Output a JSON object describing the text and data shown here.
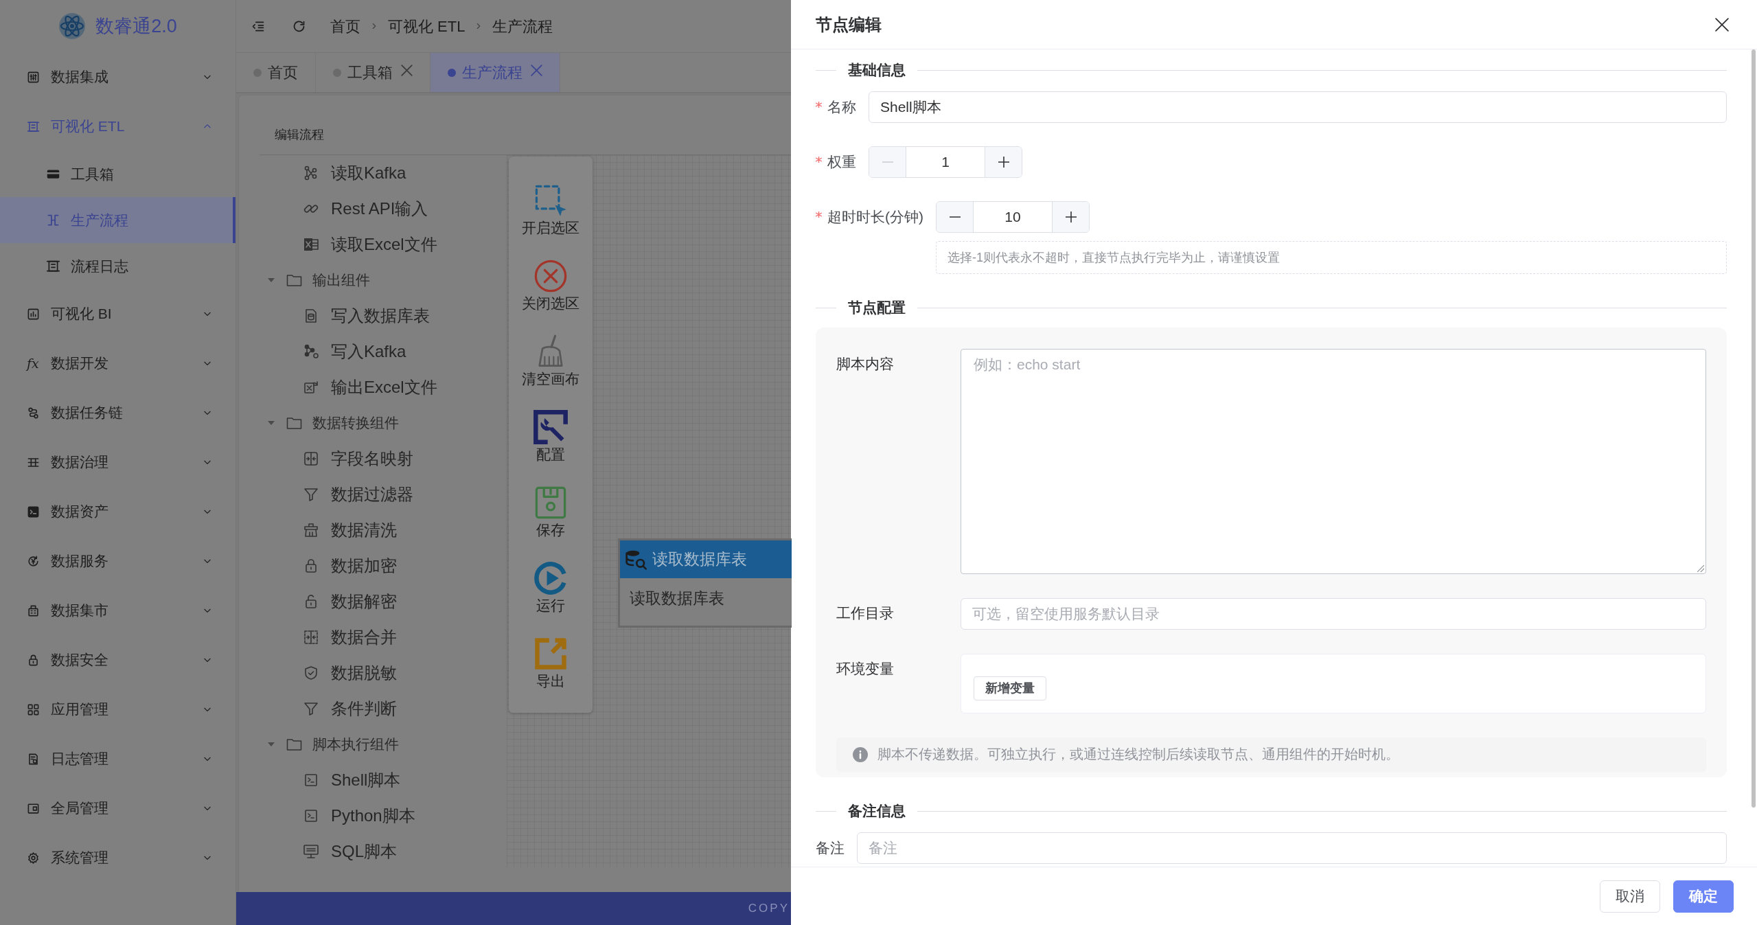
{
  "sidebar": {
    "logo": "数睿通2.0",
    "items": [
      {
        "label": "数据集成",
        "active": false,
        "expanded": false
      },
      {
        "label": "可视化 ETL",
        "active": true,
        "expanded": true,
        "children": [
          {
            "label": "工具箱",
            "selected": false
          },
          {
            "label": "生产流程",
            "selected": true
          },
          {
            "label": "流程日志",
            "selected": false
          }
        ]
      },
      {
        "label": "可视化 BI",
        "active": false,
        "expanded": false
      },
      {
        "label": "数据开发",
        "active": false,
        "expanded": false,
        "icon_text": "fx"
      },
      {
        "label": "数据任务链",
        "active": false,
        "expanded": false
      },
      {
        "label": "数据治理",
        "active": false,
        "expanded": false
      },
      {
        "label": "数据资产",
        "active": false,
        "expanded": false
      },
      {
        "label": "数据服务",
        "active": false,
        "expanded": false
      },
      {
        "label": "数据集市",
        "active": false,
        "expanded": false
      },
      {
        "label": "数据安全",
        "active": false,
        "expanded": false
      },
      {
        "label": "应用管理",
        "active": false,
        "expanded": false
      },
      {
        "label": "日志管理",
        "active": false,
        "expanded": false
      },
      {
        "label": "全局管理",
        "active": false,
        "expanded": false
      },
      {
        "label": "系统管理",
        "active": false,
        "expanded": false
      }
    ]
  },
  "breadcrumb": [
    "首页",
    "可视化 ETL",
    "生产流程"
  ],
  "tabs": [
    {
      "label": "首页",
      "selected": false,
      "closable": false
    },
    {
      "label": "工具箱",
      "selected": false,
      "closable": true
    },
    {
      "label": "生产流程",
      "selected": true,
      "closable": true
    }
  ],
  "flow_editor": {
    "title": "编辑流程",
    "component_tree": [
      {
        "children": [
          {
            "label": "读取Kafka"
          },
          {
            "label": "Rest API输入"
          },
          {
            "label": "读取Excel文件"
          }
        ]
      },
      {
        "label": "输出组件",
        "expanded": true,
        "children": [
          {
            "label": "写入数据库表"
          },
          {
            "label": "写入Kafka"
          },
          {
            "label": "输出Excel文件"
          }
        ]
      },
      {
        "label": "数据转换组件",
        "expanded": true,
        "children": [
          {
            "label": "字段名映射"
          },
          {
            "label": "数据过滤器"
          },
          {
            "label": "数据清洗"
          },
          {
            "label": "数据加密"
          },
          {
            "label": "数据解密"
          },
          {
            "label": "数据合并"
          },
          {
            "label": "数据脱敏"
          },
          {
            "label": "条件判断"
          }
        ]
      },
      {
        "label": "脚本执行组件",
        "expanded": true,
        "children": [
          {
            "label": "Shell脚本"
          },
          {
            "label": "Python脚本"
          },
          {
            "label": "SQL脚本"
          }
        ]
      }
    ],
    "toolbar": [
      "开启选区",
      "关闭选区",
      "清空画布",
      "配置",
      "保存",
      "运行",
      "导出"
    ],
    "nodes": [
      {
        "title": "读取数据库表",
        "body": "读取数据库表"
      }
    ]
  },
  "footer": {
    "text": "COPY"
  },
  "drawer": {
    "title": "节点编辑",
    "sections": [
      {
        "heading": "基础信息",
        "kind": "plain",
        "fields": [
          {
            "kind": "text",
            "label": "名称",
            "required": true,
            "value": "Shell脚本"
          },
          {
            "kind": "number",
            "label": "权重",
            "required": true,
            "value": "1",
            "decrease_disabled": true
          },
          {
            "kind": "number",
            "label": "超时时长(分钟)",
            "required": true,
            "value": "10",
            "decrease_disabled": false,
            "hint": "选择-1则代表永不超时，直接节点执行完毕为止，请谨慎设置"
          }
        ]
      },
      {
        "heading": "节点配置",
        "kind": "panel",
        "fields": [
          {
            "kind": "textarea",
            "label": "脚本内容",
            "placeholder": "例如：echo start"
          },
          {
            "kind": "text",
            "label": "工作目录",
            "placeholder": "可选，留空使用服务默认目录"
          },
          {
            "kind": "variables",
            "label": "环境变量",
            "button": "新增变量"
          }
        ],
        "note": "脚本不传递数据。可独立执行，或通过连线控制后续读取节点、通用组件的开始时机。"
      },
      {
        "heading": "备注信息",
        "kind": "plain",
        "fields": [
          {
            "kind": "text",
            "label": "备注",
            "placeholder": "备注"
          }
        ]
      }
    ],
    "buttons": [
      {
        "label": "取消",
        "kind": "default"
      },
      {
        "label": "确定",
        "kind": "primary"
      }
    ]
  }
}
